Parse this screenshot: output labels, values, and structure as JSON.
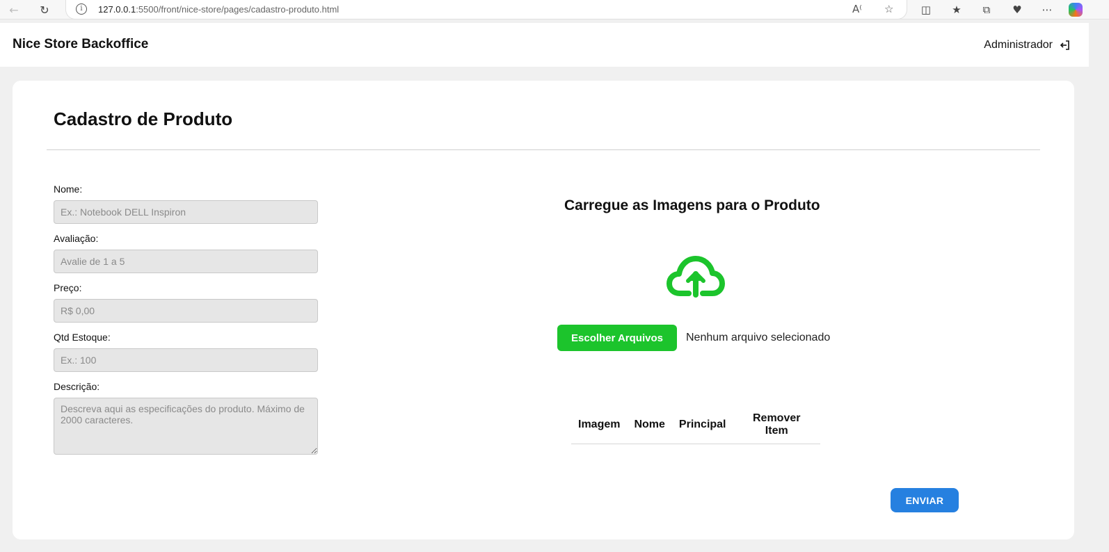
{
  "browser": {
    "url_host": "127.0.0.1",
    "url_rest": ":5500/front/nice-store/pages/cadastro-produto.html"
  },
  "header": {
    "brand": "Nice Store Backoffice",
    "user_label": "Administrador"
  },
  "page": {
    "title": "Cadastro de Produto"
  },
  "form": {
    "fields": [
      {
        "label": "Nome:",
        "placeholder": "Ex.: Notebook DELL Inspiron",
        "value": ""
      },
      {
        "label": "Avaliação:",
        "placeholder": "Avalie de 1 a 5",
        "value": ""
      },
      {
        "label": "Preço:",
        "placeholder": "R$ 0,00",
        "value": ""
      },
      {
        "label": "Qtd Estoque:",
        "placeholder": "Ex.: 100",
        "value": ""
      }
    ],
    "description": {
      "label": "Descrição:",
      "placeholder": "Descreva aqui as especificações do produto. Máximo de 2000 caracteres.",
      "value": ""
    }
  },
  "upload": {
    "title": "Carregue as Imagens para o Produto",
    "icon": "cloud-upload-icon",
    "choose_label": "Escolher Arquivos",
    "file_status": "Nenhum arquivo selecionado",
    "table_headers": [
      "Imagem",
      "Nome",
      "Principal",
      "Remover Item"
    ]
  },
  "actions": {
    "submit_label": "ENVIAR"
  },
  "colors": {
    "accent_green": "#1cc42c",
    "accent_blue": "#2680e0"
  }
}
